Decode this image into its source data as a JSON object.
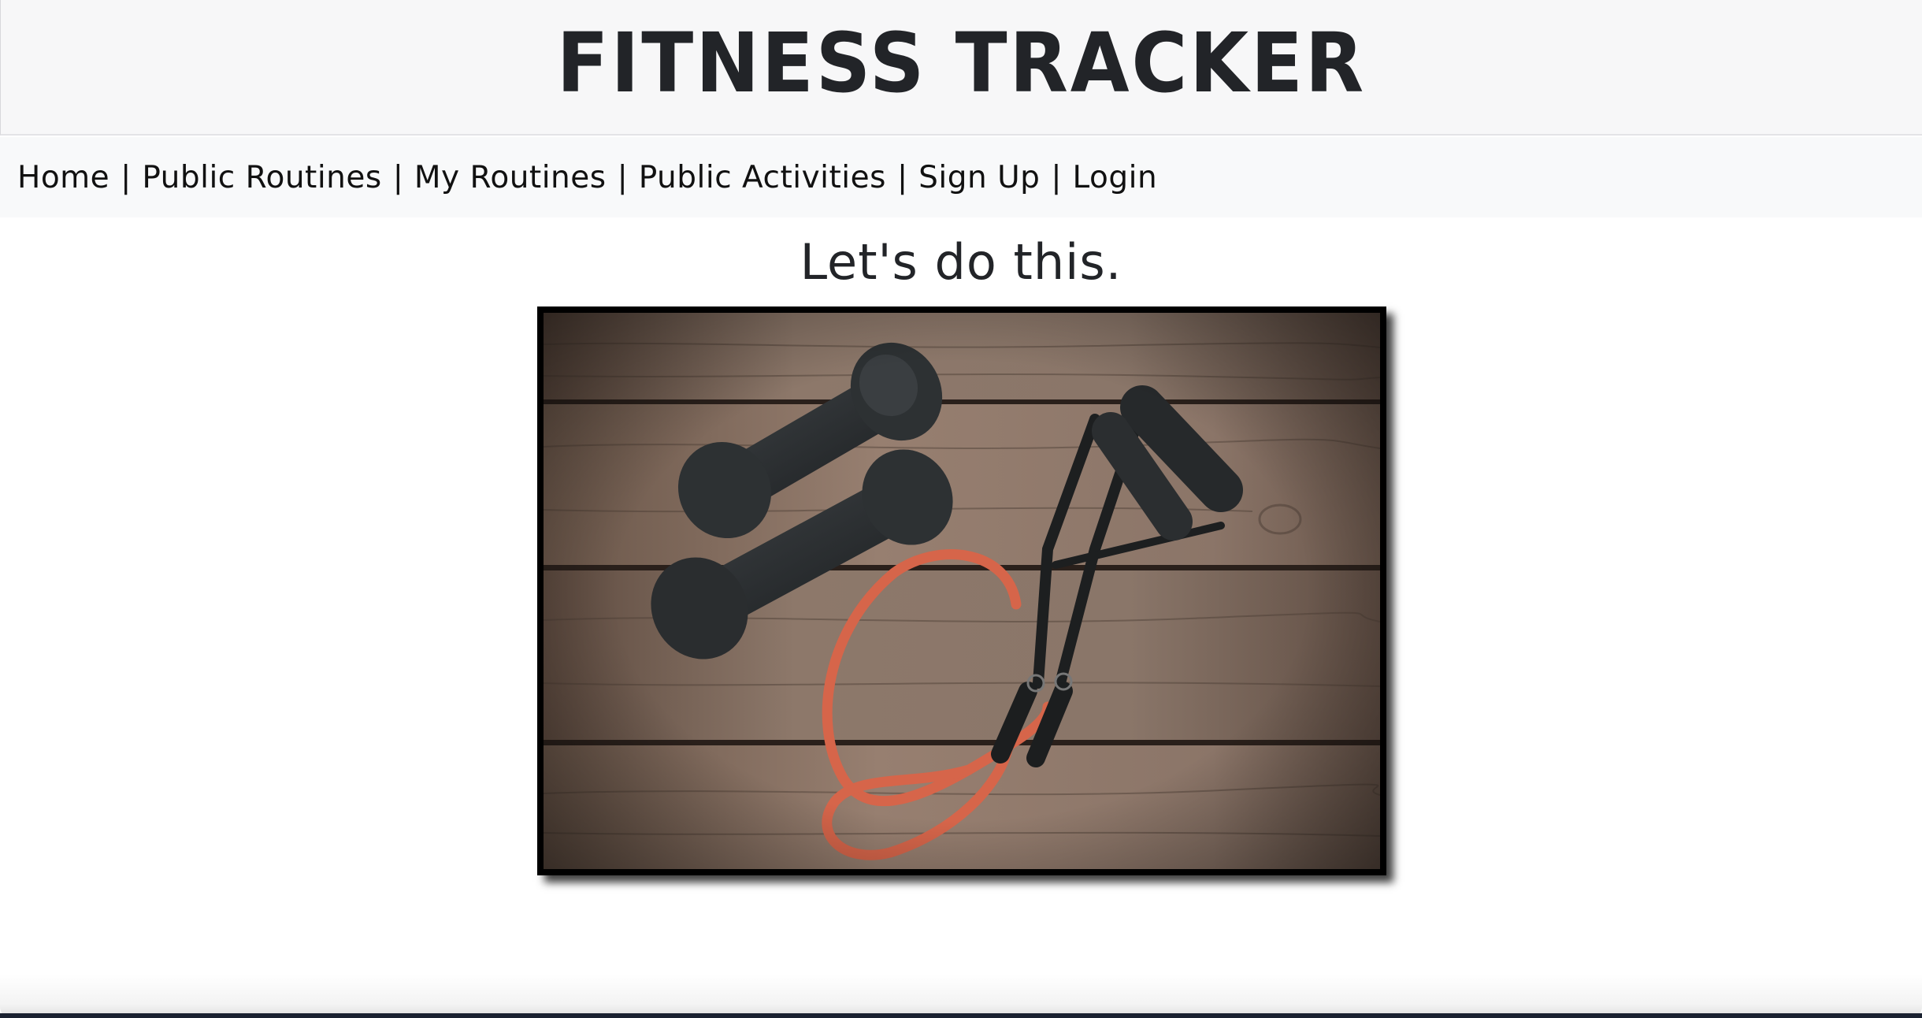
{
  "header": {
    "title": "FITNESS TRACKER"
  },
  "nav": {
    "items": [
      {
        "label": "Home"
      },
      {
        "label": "Public Routines"
      },
      {
        "label": "My Routines"
      },
      {
        "label": "Public Activities"
      },
      {
        "label": "Sign Up"
      },
      {
        "label": "Login"
      }
    ],
    "separator": "|"
  },
  "main": {
    "tagline": "Let's do this.",
    "hero_image": {
      "description_icon": "dumbbells-and-resistance-band-image",
      "colors": {
        "wood_light": "#8a7566",
        "wood_dark": "#5a4a40",
        "dumbbell": "#2a2d2f",
        "band": "#d9674a"
      }
    }
  },
  "theme": {
    "header_bg": "#f7f7f8",
    "nav_bg": "#f8f9fa",
    "text": "#222428"
  }
}
